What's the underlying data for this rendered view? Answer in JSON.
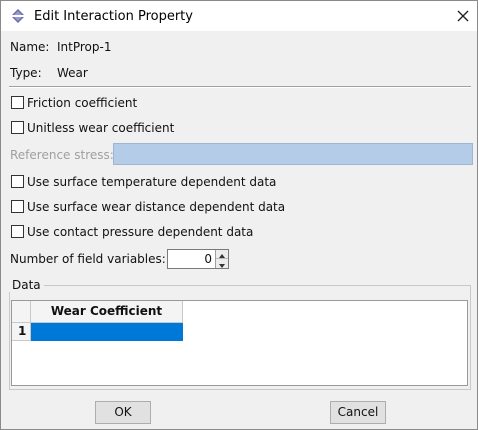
{
  "window": {
    "title": "Edit Interaction Property",
    "icon": "abaqus-app-icon",
    "close_icon": "close-icon"
  },
  "info": {
    "name_label": "Name:",
    "name_value": "IntProp-1",
    "type_label": "Type:",
    "type_value": "Wear"
  },
  "options": {
    "friction": {
      "label": "Friction coefficient",
      "checked": false
    },
    "unitless": {
      "label": "Unitless wear coefficient",
      "checked": false
    },
    "reference_stress": {
      "label": "Reference stress:",
      "value": "",
      "enabled": false
    },
    "temperature": {
      "label": "Use surface temperature dependent data",
      "checked": false
    },
    "wear_distance": {
      "label": "Use surface wear distance dependent data",
      "checked": false
    },
    "contact_pressure": {
      "label": "Use contact pressure dependent data",
      "checked": false
    },
    "field_variables": {
      "label": "Number of field variables:",
      "value": "0"
    }
  },
  "data_group": {
    "title": "Data",
    "columns": [
      "Wear Coefficient"
    ],
    "rows": [
      {
        "index": "1",
        "cells": [
          ""
        ]
      }
    ],
    "selection_color": "#0078d7"
  },
  "buttons": {
    "ok": "OK",
    "cancel": "Cancel"
  },
  "colors": {
    "dialog_bg": "#f0f0f0",
    "disabled_field": "#b4cce8"
  }
}
